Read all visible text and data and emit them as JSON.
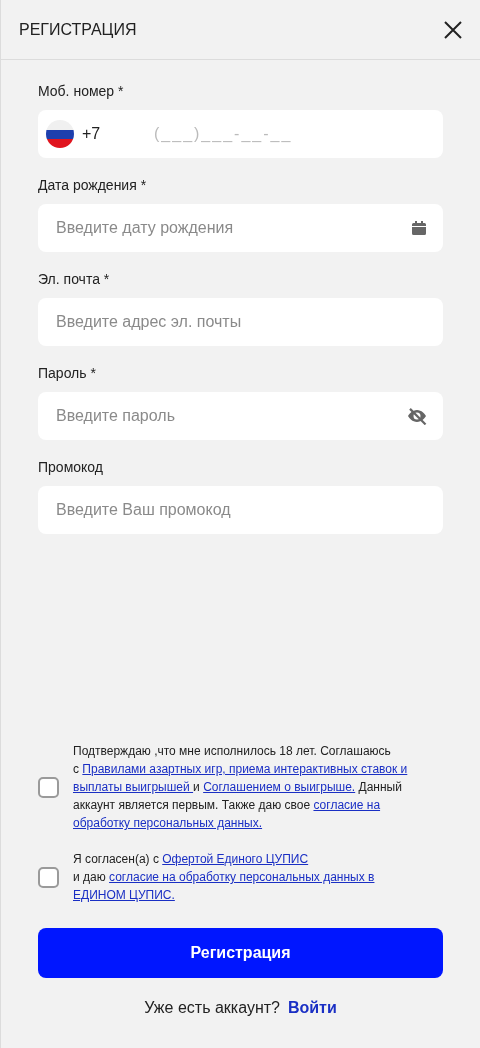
{
  "header": {
    "title": "РЕГИСТРАЦИЯ"
  },
  "fields": [
    {
      "kind": "phone",
      "label": "Моб. номер *",
      "code": "+7",
      "placeholder": "(___)___-__-__"
    },
    {
      "kind": "date",
      "label": "Дата рождения *",
      "placeholder": "Введите дату рождения"
    },
    {
      "kind": "email",
      "label": "Эл. почта *",
      "placeholder": "Введите адрес эл. почты"
    },
    {
      "kind": "password",
      "label": "Пароль *",
      "placeholder": "Введите пароль"
    },
    {
      "kind": "promo",
      "label": "Промокод",
      "placeholder": "Введите Ваш промокод"
    }
  ],
  "consents": [
    {
      "checked": false,
      "lines": [
        [
          {
            "text": "Подтверждаю ,что мне исполнилось 18 лет. Соглашаюсь",
            "link": false
          }
        ],
        [
          {
            "text": "с ",
            "link": false
          },
          {
            "text": "Правилами азартных игр, приема интерактивных ставок и",
            "link": true
          }
        ],
        [
          {
            "text": "выплаты выигрышей ",
            "link": true
          },
          {
            "text": "и ",
            "link": false
          },
          {
            "text": "Соглашением о выигрыше.",
            "link": true
          },
          {
            "text": " Данный",
            "link": false
          }
        ],
        [
          {
            "text": "аккаунт является первым. Также даю свое ",
            "link": false
          },
          {
            "text": "согласие на",
            "link": true
          }
        ],
        [
          {
            "text": "обработку персональных данных.",
            "link": true
          }
        ]
      ]
    },
    {
      "checked": false,
      "lines": [
        [
          {
            "text": "Я согласен(а) с ",
            "link": false
          },
          {
            "text": "Офертой Единого ЦУПИС",
            "link": true
          }
        ],
        [
          {
            "text": "и даю ",
            "link": false
          },
          {
            "text": "согласие на обработку персональных данных в",
            "link": true
          }
        ],
        [
          {
            "text": "ЕДИНОМ ЦУПИС.",
            "link": true
          }
        ]
      ]
    }
  ],
  "submit": "Регистрация",
  "login": {
    "text": "Уже есть аккаунт?",
    "link": "Войти"
  }
}
